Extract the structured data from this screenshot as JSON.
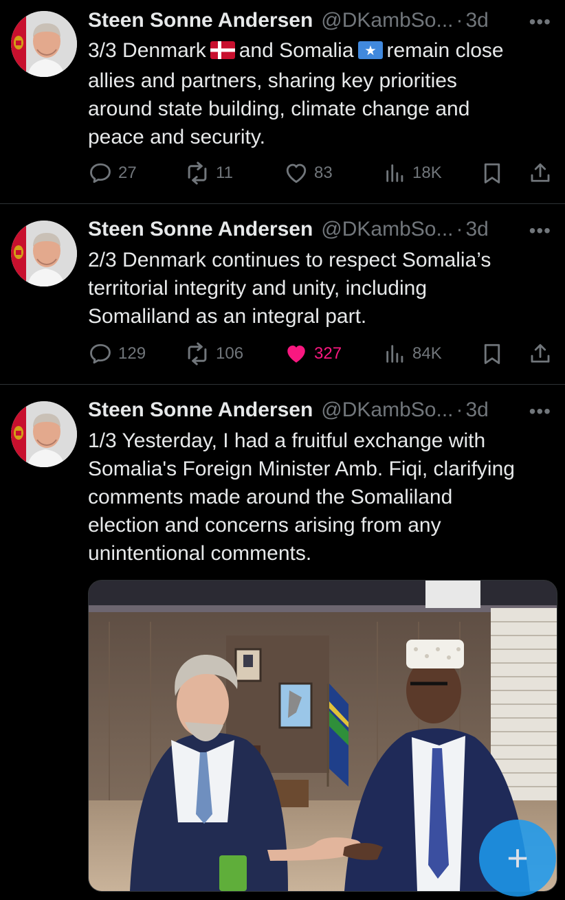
{
  "tweets": [
    {
      "name": "Steen Sonne Andersen",
      "handle": "@DKambSo...",
      "dot": "·",
      "time": "3d",
      "text_parts": [
        "3/3 Denmark",
        "and Somalia",
        "remain close\nallies and partners, sharing key priorities\naround state building, climate change and\npeace and security."
      ],
      "replies": "27",
      "retweets": "11",
      "likes": "83",
      "views": "18K",
      "liked": false
    },
    {
      "name": "Steen Sonne Andersen",
      "handle": "@DKambSo...",
      "dot": "·",
      "time": "3d",
      "text": "2/3 Denmark continues to respect Somalia’s\nterritorial integrity and unity, including\nSomaliland as an integral part.",
      "replies": "129",
      "retweets": "106",
      "likes": "327",
      "views": "84K",
      "liked": true
    },
    {
      "name": "Steen Sonne Andersen",
      "handle": "@DKambSo...",
      "dot": "·",
      "time": "3d",
      "text": "1/3 Yesterday, I had a fruitful exchange with\nSomalia's Foreign Minister Amb. Fiqi, clarifying\ncomments made around the Somaliland\nelection and concerns arising from any\nunintentional comments."
    }
  ],
  "more_glyph": "•••",
  "fab_glyph": "+",
  "colors": {
    "background": "#000000",
    "text": "#e7e9ea",
    "muted": "#71767b",
    "like": "#f91880",
    "accent": "#1d9bf0",
    "divider": "#2f3336"
  },
  "icons": [
    "reply-icon",
    "retweet-icon",
    "heart-icon",
    "views-icon",
    "bookmark-icon",
    "share-icon",
    "more-icon",
    "compose-icon"
  ]
}
